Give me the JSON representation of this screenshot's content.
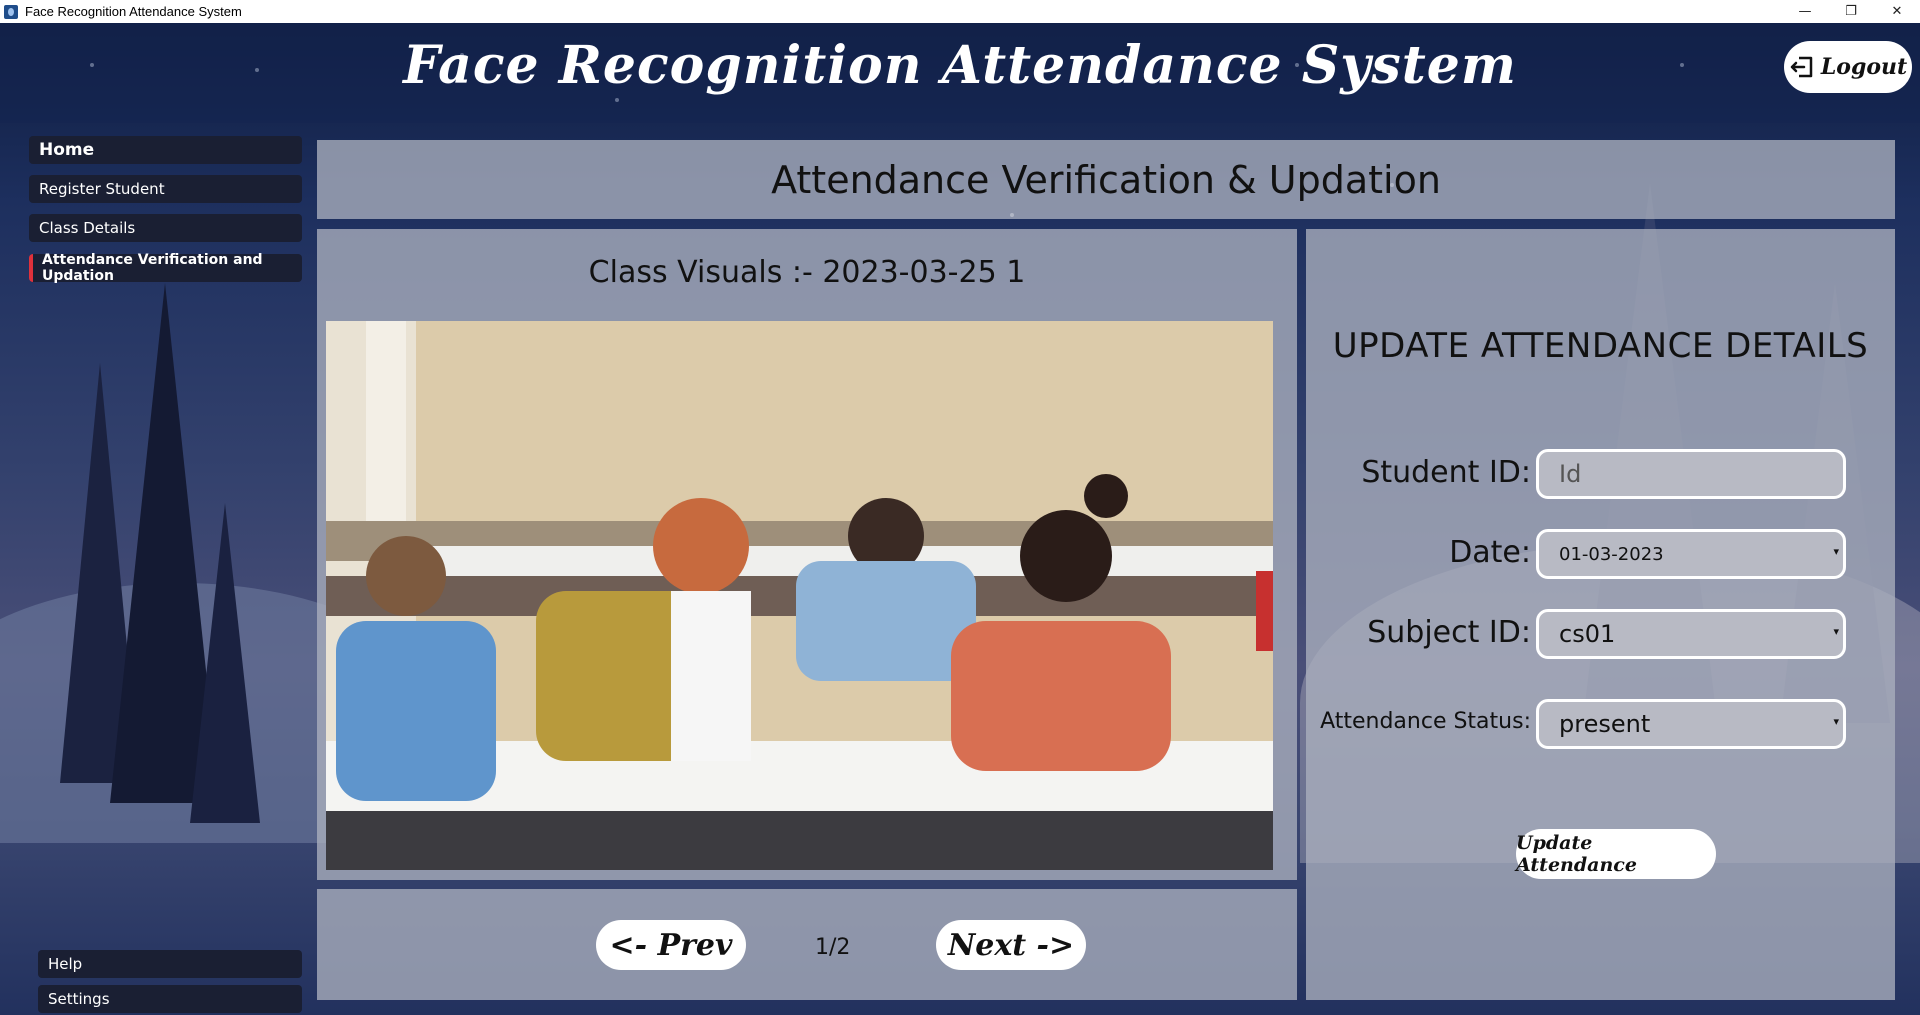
{
  "window": {
    "title": "Face Recognition Attendance System",
    "controls": {
      "minimize": "—",
      "maximize": "❐",
      "close": "✕"
    }
  },
  "header": {
    "app_title": "Face Recognition Attendance System",
    "logout_label": "Logout",
    "logout_icon": "logout-icon"
  },
  "sidebar": {
    "items": [
      {
        "label": "Home"
      },
      {
        "label": "Register Student"
      },
      {
        "label": "Class Details"
      },
      {
        "label": "Attendance Verification and Updation"
      }
    ],
    "active_index": 3,
    "bottom_items": [
      {
        "label": "Help"
      },
      {
        "label": "Settings"
      }
    ],
    "active_indicator_color": "#e0313b"
  },
  "page": {
    "heading": "Attendance Verification & Updation"
  },
  "visuals": {
    "title": "Class Visuals :-   2023-03-25  1",
    "image": "classroom-photo",
    "prev_label": "<- Prev",
    "next_label": "Next ->",
    "page_count": "1/2"
  },
  "form": {
    "title": "UPDATE ATTENDANCE DETAILS",
    "student_id": {
      "label": "Student ID:",
      "placeholder": "Id",
      "value": ""
    },
    "date": {
      "label": "Date:",
      "value": "01-03-2023"
    },
    "subject_id": {
      "label": "Subject ID:",
      "value": "cs01"
    },
    "status": {
      "label": "Attendance Status:",
      "value": "present"
    },
    "submit_label": "Update Attendance"
  }
}
